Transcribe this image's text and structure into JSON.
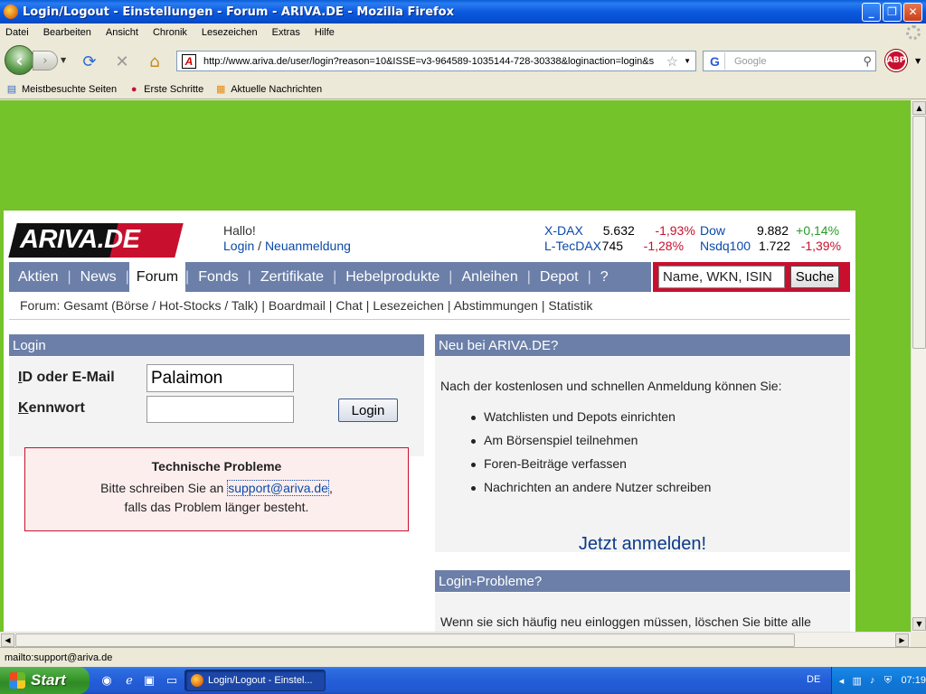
{
  "window": {
    "title": "Login/Logout - Einstellungen - Forum - ARIVA.DE - Mozilla Firefox",
    "controls": {
      "minimize": "_",
      "maximize": "❐",
      "close": "✕"
    }
  },
  "menu": [
    "Datei",
    "Bearbeiten",
    "Ansicht",
    "Chronik",
    "Lesezeichen",
    "Extras",
    "Hilfe"
  ],
  "toolbar": {
    "url": "http://www.ariva.de/user/login?reason=10&ISSE=v3-964589-1035144-728-30338&loginaction=login&s",
    "search_placeholder": "Google",
    "abp_label": "ABP"
  },
  "bookmarks": [
    "Meistbesuchte Seiten",
    "Erste Schritte",
    "Aktuelle Nachrichten"
  ],
  "site": {
    "logo": "ARIVA.DE",
    "greeting": "Hallo!",
    "login_link": "Login",
    "slash": " / ",
    "register_link": "Neuanmeldung",
    "ticker": [
      {
        "name": "X-DAX",
        "value": "5.632",
        "change": "-1,93%",
        "trend": "neg"
      },
      {
        "name": "L-TecDAX",
        "value": "745",
        "change": "-1,28%",
        "trend": "neg"
      },
      {
        "name": "Dow",
        "value": "9.882",
        "change": "+0,14%",
        "trend": "pos"
      },
      {
        "name": "Nsdq100",
        "value": "1.722",
        "change": "-1,39%",
        "trend": "neg"
      }
    ],
    "nav": [
      "Aktien",
      "News",
      "Forum",
      "Fonds",
      "Zertifikate",
      "Hebelprodukte",
      "Anleihen",
      "Depot",
      "?"
    ],
    "nav_active": "Forum",
    "search_value": "Name, WKN, ISIN",
    "search_button": "Suche",
    "subnav": "Forum: Gesamt (Börse / Hot-Stocks / Talk) | Boardmail | Chat | Lesezeichen | Abstimmungen | Statistik"
  },
  "login": {
    "heading": "Login",
    "id_label": "ID oder E-Mail",
    "id_value": "Palaimon",
    "password_label": "Kennwort",
    "password_value": "",
    "button": "Login",
    "error_title": "Technische Probleme",
    "error_line1": "Bitte schreiben Sie an ",
    "error_mail": "support@ariva.de",
    "error_comma": ",",
    "error_line2": "falls das Problem länger besteht."
  },
  "new_user": {
    "heading": "Neu bei ARIVA.DE?",
    "intro": "Nach der kostenlosen und schnellen Anmeldung können Sie:",
    "bullets": [
      "Watchlisten und Depots einrichten",
      "Am Börsenspiel teilnehmen",
      "Foren-Beiträge verfassen",
      "Nachrichten an andere Nutzer schreiben"
    ],
    "cta": "Jetzt anmelden!"
  },
  "login_problems": {
    "heading": "Login-Probleme?",
    "text": "Wenn sie sich häufig neu einloggen müssen, löschen Sie bitte alle"
  },
  "status_text": "mailto:support@ariva.de",
  "taskbar": {
    "start": "Start",
    "task": "Login/Logout - Einstel...",
    "lang": "DE",
    "clock": "07:19"
  },
  "colors": {
    "brand_red": "#c8102e",
    "nav_blue": "#6b7fa8",
    "page_green": "#74c32a"
  }
}
